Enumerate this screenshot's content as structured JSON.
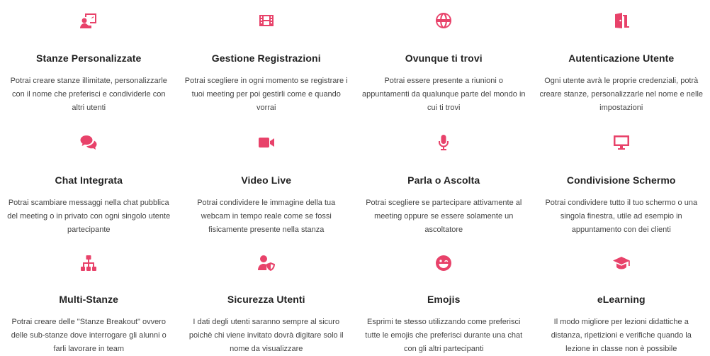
{
  "accent_color": "#e8426a",
  "features": [
    {
      "icon": "presentation-user-icon",
      "title": "Stanze Personalizzate",
      "description": "Potrai creare stanze illimitate, personalizzarle con il nome che preferisci e condividerle con altri utenti"
    },
    {
      "icon": "film-icon",
      "title": "Gestione Registrazioni",
      "description": "Potrai scegliere in ogni momento se registrare i tuoi meeting per poi gestirli come e quando vorrai"
    },
    {
      "icon": "globe-icon",
      "title": "Ovunque ti trovi",
      "description": "Potrai essere presente a riunioni o appuntamenti da qualunque parte del mondo in cui ti trovi"
    },
    {
      "icon": "door-open-icon",
      "title": "Autenticazione Utente",
      "description": "Ogni utente avrà le proprie credenziali, potrà creare stanze, personalizzarle nel nome e nelle impostazioni"
    },
    {
      "icon": "chat-bubbles-icon",
      "title": "Chat Integrata",
      "description": "Potrai scambiare messaggi nella chat pubblica del meeting o in privato con ogni singolo utente partecipante"
    },
    {
      "icon": "video-camera-icon",
      "title": "Video Live",
      "description": "Potrai condividere le immagine della tua webcam in tempo reale come se fossi fisicamente presente nella stanza"
    },
    {
      "icon": "microphone-icon",
      "title": "Parla o Ascolta",
      "description": "Potrai scegliere se partecipare attivamente al meeting oppure se essere solamente un ascoltatore"
    },
    {
      "icon": "desktop-monitor-icon",
      "title": "Condivisione Schermo",
      "description": "Potrai condividere tutto il tuo schermo o una singola finestra, utile ad esempio in appuntamento con dei clienti"
    },
    {
      "icon": "sitemap-icon",
      "title": "Multi-Stanze",
      "description": "Potrai creare delle \"Stanze Breakout\" ovvero delle sub-stanze dove interrogare gli alunni o farli lavorare in team"
    },
    {
      "icon": "user-shield-icon",
      "title": "Sicurezza Utenti",
      "description": "I dati degli utenti saranno sempre al sicuro poichè chi viene invitato dovrà digitare solo il nome da visualizzare"
    },
    {
      "icon": "grin-wink-icon",
      "title": "Emojis",
      "description": "Esprimi te stesso utilizzando come preferisci tutte le emojis che preferisci durante una chat con gli altri partecipanti"
    },
    {
      "icon": "graduation-cap-icon",
      "title": "eLearning",
      "description": "Il modo migliore per lezioni didattiche a distanza, ripetizioni e verifiche quando la lezione in classe non è possibile"
    }
  ]
}
